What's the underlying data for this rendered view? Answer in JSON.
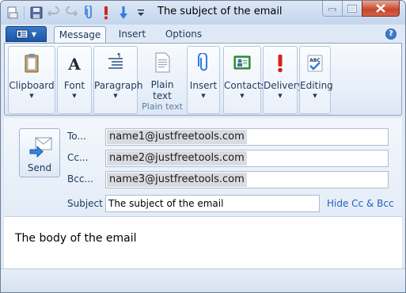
{
  "window": {
    "title": "The subject of the email"
  },
  "tabs": [
    {
      "label": "Message"
    },
    {
      "label": "Insert"
    },
    {
      "label": "Options"
    }
  ],
  "ribbon": {
    "clipboard": "Clipboard",
    "font": "Font",
    "paragraph": "Paragraph",
    "plain_text_line1": "Plain",
    "plain_text_line2": "text",
    "plain_text_group": "Plain text",
    "insert": "Insert",
    "contacts": "Contacts",
    "delivery": "Delivery",
    "editing": "Editing",
    "dropdown_glyph": "▼",
    "help_glyph": "?"
  },
  "compose": {
    "send_label": "Send",
    "to_label": "To...",
    "cc_label": "Cc...",
    "bcc_label": "Bcc...",
    "subject_label": "Subject",
    "to_value": "name1@justfreetools.com",
    "cc_value": "name2@justfreetools.com",
    "bcc_value": "name3@justfreetools.com",
    "subject_value": "The subject of the email",
    "hide_cc_bcc": "Hide Cc & Bcc",
    "body": "The body of the email"
  },
  "colors": {
    "accent": "#1c56a8",
    "link": "#1f63b7",
    "delivery_red": "#d1261c"
  }
}
